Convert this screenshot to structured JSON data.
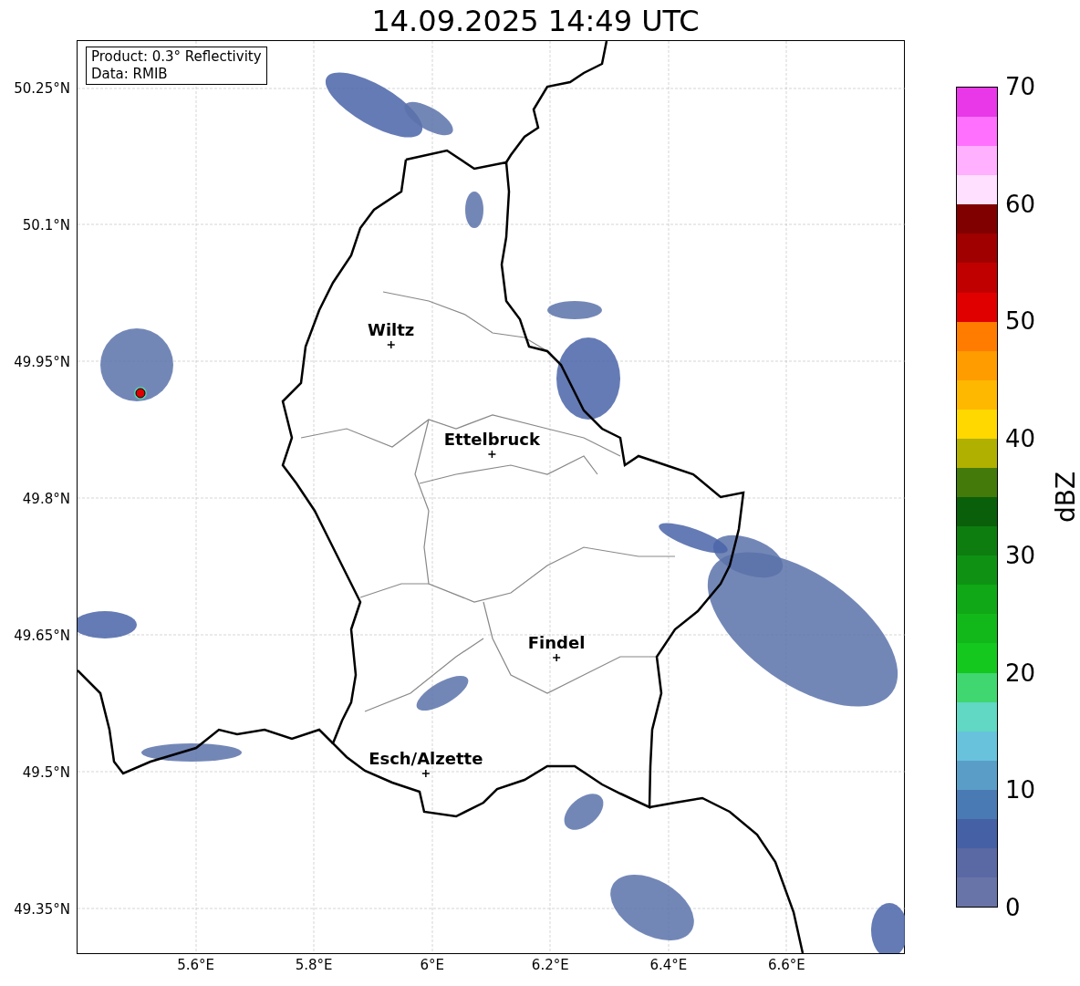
{
  "title": "14.09.2025 14:49 UTC",
  "info_box": [
    "Product: 0.3° Reflectivity",
    "Data: RMIB"
  ],
  "map": {
    "cities": [
      {
        "name": "Wiltz"
      },
      {
        "name": "Ettelbruck"
      },
      {
        "name": "Findel"
      },
      {
        "name": "Esch/Alzette"
      }
    ]
  },
  "x_ticks": [
    "5.6°E",
    "5.8°E",
    "6°E",
    "6.2°E",
    "6.4°E",
    "6.6°E"
  ],
  "y_ticks": [
    "50.25°N",
    "50.1°N",
    "49.95°N",
    "49.8°N",
    "49.65°N",
    "49.5°N",
    "49.35°N"
  ],
  "colorbar": {
    "label": "dBZ",
    "ticks": [
      "70",
      "60",
      "50",
      "40",
      "30",
      "20",
      "10",
      "0"
    ],
    "segments": [
      {
        "color": "#e838e8"
      },
      {
        "color": "#ff70ff"
      },
      {
        "color": "#ffb0ff"
      },
      {
        "color": "#ffe0ff"
      },
      {
        "color": "#800000"
      },
      {
        "color": "#a00000"
      },
      {
        "color": "#c00000"
      },
      {
        "color": "#e00000"
      },
      {
        "color": "#ff7c00"
      },
      {
        "color": "#ff9c00"
      },
      {
        "color": "#ffb800"
      },
      {
        "color": "#ffd800"
      },
      {
        "color": "#b0b000"
      },
      {
        "color": "#437a0a"
      },
      {
        "color": "#0a600a"
      },
      {
        "color": "#0d7d10"
      },
      {
        "color": "#0f9214"
      },
      {
        "color": "#10a816"
      },
      {
        "color": "#12b81a"
      },
      {
        "color": "#14c81e"
      },
      {
        "color": "#40d670"
      },
      {
        "color": "#60d8c4"
      },
      {
        "color": "#68c2dc"
      },
      {
        "color": "#5a9ec8"
      },
      {
        "color": "#4a7ab4"
      },
      {
        "color": "#4660a6"
      },
      {
        "color": "#5a68a4"
      },
      {
        "color": "#6873a8"
      }
    ]
  }
}
